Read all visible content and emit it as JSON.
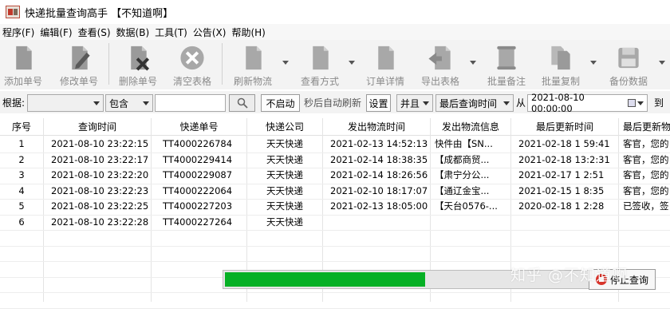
{
  "window": {
    "title": "快递批量查询高手 【不知道啊】"
  },
  "menu": [
    "程序(F)",
    "编辑(F)",
    "查看(S)",
    "数据(B)",
    "工具(T)",
    "公告(X)",
    "帮助(H)"
  ],
  "toolbar": {
    "add": "添加单号",
    "edit": "修改单号",
    "delete": "删除单号",
    "clear": "清空表格",
    "refresh": "刷新物流",
    "view_mode": "查看方式",
    "order_detail": "订单详情",
    "export": "导出表格",
    "batch_note": "批量备注",
    "batch_copy": "批量复制",
    "backup": "备份数据"
  },
  "filter": {
    "by_label": "根据:",
    "field_value": "",
    "match_value": "包含",
    "keyword": "",
    "auto_refresh_value": "不启动",
    "auto_refresh_suffix": "秒后自动刷新",
    "settings_button": "设置",
    "logic_value": "并且",
    "time_field": "最后查询时间",
    "from_label": "从",
    "from_date": "2021-08-10 00:00:00",
    "to_label": "到"
  },
  "table": {
    "headers": [
      "序号",
      "查询时间",
      "快递单号",
      "快递公司",
      "发出物流时间",
      "发出物流信息",
      "最后更新时间",
      "最后更新物"
    ],
    "rows": [
      [
        "1",
        "2021-08-10 23:22:15",
        "TT4000226784",
        "天天快递",
        "2021-02-13 14:52:13",
        "快件由【SN...",
        "2021-02-18 1 59:41",
        "客官，您的"
      ],
      [
        "2",
        "2021-08-10 23:22:17",
        "TT4000229414",
        "天天快递",
        "2021-02-14 18:38:35",
        "【成都商贸...",
        "2021-02-18 13:2:31",
        "客官，您的"
      ],
      [
        "3",
        "2021-08-10 23:22:20",
        "TT4000229087",
        "天天快递",
        "2021-02-14 18:26:56",
        "【肃宁分公...",
        "2021-02-17 1 2:51",
        "客官，您的"
      ],
      [
        "4",
        "2021-08-10 23:22:23",
        "TT4000222064",
        "天天快递",
        "2021-02-10 18:17:07",
        "【通辽金宝...",
        "2021-02-15 1 8:35",
        "客官，您的"
      ],
      [
        "5",
        "2021-08-10 23:22:25",
        "TT4000227203",
        "天天快递",
        "2021-02-13 18:05:00",
        "【天台0576-...",
        "2020-02-18 1 2:28",
        "已签收，签"
      ],
      [
        "6",
        "2021-08-10 23:22:28",
        "TT4000227264",
        "天天快递",
        "",
        "",
        "",
        ""
      ]
    ]
  },
  "progress": {
    "value": 0.55
  },
  "stop_button": "停止查询",
  "watermark": "知乎 @不知道啊"
}
